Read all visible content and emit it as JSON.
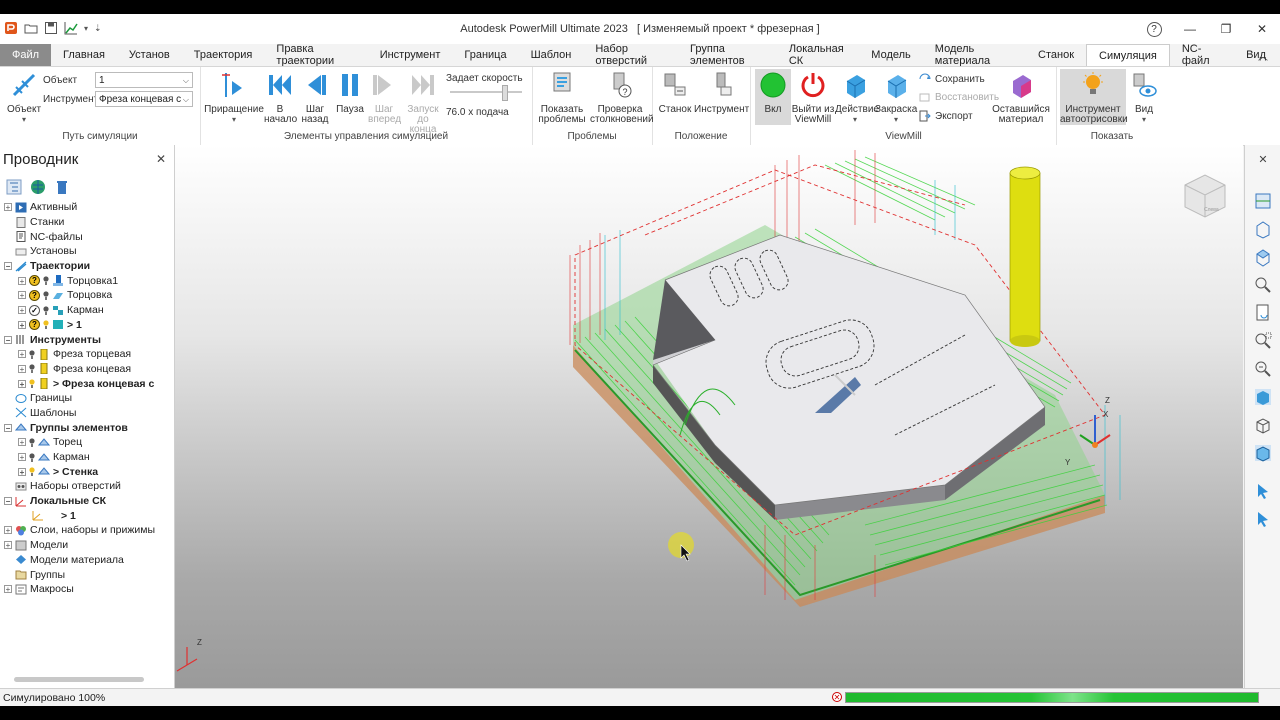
{
  "window": {
    "title": "Autodesk PowerMill Ultimate 2023",
    "project": "[ Изменяемый проект * фрезерная ]",
    "help_label": "?"
  },
  "tabs": [
    "Файл",
    "Главная",
    "Установ",
    "Траектория",
    "Правка траектории",
    "Инструмент",
    "Граница",
    "Шаблон",
    "Набор отверстий",
    "Группа элементов",
    "Локальная СК",
    "Модель",
    "Модель материала",
    "Станок",
    "Симуляция",
    "NC-файл",
    "Вид"
  ],
  "active_tab": "Симуляция",
  "ribbon": {
    "sim_path": {
      "label": "Путь симуляции",
      "object_btn": "Объект",
      "object_field_label": "Объект",
      "object_value": "1",
      "tool_field_label": "Инструмент",
      "tool_value": "Фреза концевая с"
    },
    "controls": {
      "label": "Элементы управления симуляцией",
      "increment": "Приращение",
      "to_start_1": "В",
      "to_start_2": "начало",
      "step_back_1": "Шаг",
      "step_back_2": "назад",
      "pause": "Пауза",
      "step_fwd_1": "Шаг",
      "step_fwd_2": "вперед",
      "run_end_1": "Запуск",
      "run_end_2": "до конца",
      "speed_label": "Задает скорость",
      "feed_value": "76.0 x подача"
    },
    "problems": {
      "label": "Проблемы",
      "show_1": "Показать",
      "show_2": "проблемы",
      "check_1": "Проверка",
      "check_2": "столкновений"
    },
    "position": {
      "label": "Положение",
      "machine": "Станок",
      "tool": "Инструмент"
    },
    "viewmill": {
      "label": "ViewMill",
      "on": "Вкл",
      "exit_1": "Выйти из",
      "exit_2": "ViewMill",
      "action": "Действие",
      "shading": "Закраска",
      "save": "Сохранить",
      "restore": "Восстановить",
      "export": "Экспорт",
      "remaining_1": "Оставшийся",
      "remaining_2": "материал"
    },
    "show": {
      "label": "Показать",
      "autodraw_1": "Инструмент",
      "autodraw_2": "автоотрисовки",
      "view": "Вид"
    }
  },
  "explorer": {
    "title": "Проводник",
    "items": [
      {
        "label": "Активный"
      },
      {
        "label": "Станки"
      },
      {
        "label": "NC-файлы"
      },
      {
        "label": "Установы"
      },
      {
        "label": "Траектории"
      },
      {
        "label": "Торцовка1"
      },
      {
        "label": "Торцовка"
      },
      {
        "label": "Карман"
      },
      {
        "label": "> 1"
      },
      {
        "label": "Инструменты"
      },
      {
        "label": "Фреза торцевая"
      },
      {
        "label": "Фреза концевая"
      },
      {
        "label": "> Фреза концевая с"
      },
      {
        "label": "Границы"
      },
      {
        "label": "Шаблоны"
      },
      {
        "label": "Группы элементов"
      },
      {
        "label": "Торец"
      },
      {
        "label": "Карман"
      },
      {
        "label": "> Стенка"
      },
      {
        "label": "Наборы отверстий"
      },
      {
        "label": "Локальные СК"
      },
      {
        "label": "> 1"
      },
      {
        "label": "Слои, наборы и прижимы"
      },
      {
        "label": "Модели"
      },
      {
        "label": "Модели материала"
      },
      {
        "label": "Группы"
      },
      {
        "label": "Макросы"
      }
    ]
  },
  "viewport": {
    "axis_z": "Z",
    "axis_x": "X",
    "axis_y": "Y",
    "cube_label": "Слева"
  },
  "status": {
    "text": "Симулировано 100%",
    "progress_percent": 100
  },
  "colors": {
    "accent_blue": "#2f8fd8",
    "sim_green": "#22c233",
    "tool_yellow": "#dede10",
    "file_tab": "#8b8b8b"
  }
}
